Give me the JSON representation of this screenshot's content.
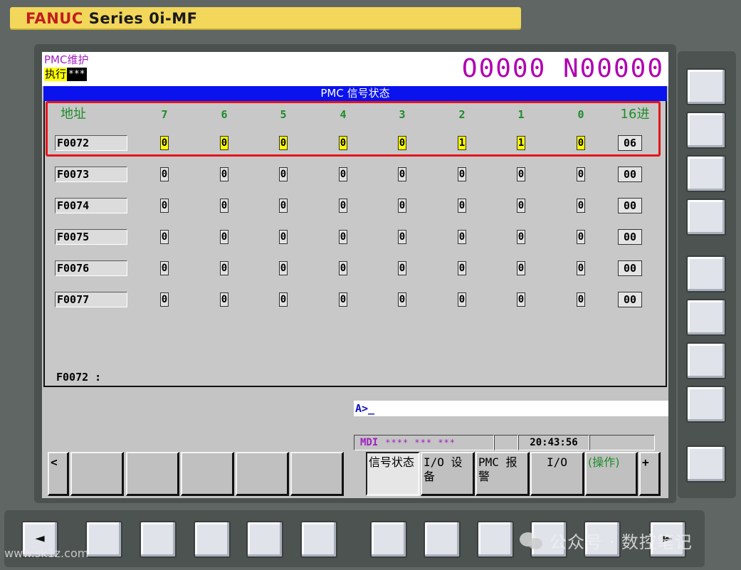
{
  "brand": {
    "maker": "FANUC",
    "series": "Series 0i-MF"
  },
  "header": {
    "screen_label": "PMC维护",
    "run_label": "执行",
    "run_status": "***",
    "program": "O0000 N00000"
  },
  "title": "PMC 信号状态",
  "columns": {
    "addr": "地址",
    "bits": [
      "7",
      "6",
      "5",
      "4",
      "3",
      "2",
      "1",
      "0"
    ],
    "hex": "16进"
  },
  "rows": [
    {
      "addr": "F0072",
      "bits": [
        "0",
        "0",
        "0",
        "0",
        "0",
        "1",
        "1",
        "0"
      ],
      "hex": "06"
    },
    {
      "addr": "F0073",
      "bits": [
        "0",
        "0",
        "0",
        "0",
        "0",
        "0",
        "0",
        "0"
      ],
      "hex": "00"
    },
    {
      "addr": "F0074",
      "bits": [
        "0",
        "0",
        "0",
        "0",
        "0",
        "0",
        "0",
        "0"
      ],
      "hex": "00"
    },
    {
      "addr": "F0075",
      "bits": [
        "0",
        "0",
        "0",
        "0",
        "0",
        "0",
        "0",
        "0"
      ],
      "hex": "00"
    },
    {
      "addr": "F0076",
      "bits": [
        "0",
        "0",
        "0",
        "0",
        "0",
        "0",
        "0",
        "0"
      ],
      "hex": "00"
    },
    {
      "addr": "F0077",
      "bits": [
        "0",
        "0",
        "0",
        "0",
        "0",
        "0",
        "0",
        "0"
      ],
      "hex": "00"
    }
  ],
  "cursor_address": "F0072 :",
  "input_prompt": "A>_",
  "status": {
    "mode": "MDI",
    "stars": "**** *** ***",
    "time": "20:43:56"
  },
  "softkeys": {
    "prev": "<",
    "signal_status": "信号状态",
    "io_device": "I/O 设备",
    "pmc_alarm": "PMC 报警",
    "io": "I/O",
    "operation": "(操作)",
    "next": "+"
  },
  "watermarks": {
    "wechat": "公众号 · 数控笔记",
    "site": "www.sk1z.com"
  },
  "highlight_color": "#ffff00",
  "annotation_color": "#e4141a"
}
